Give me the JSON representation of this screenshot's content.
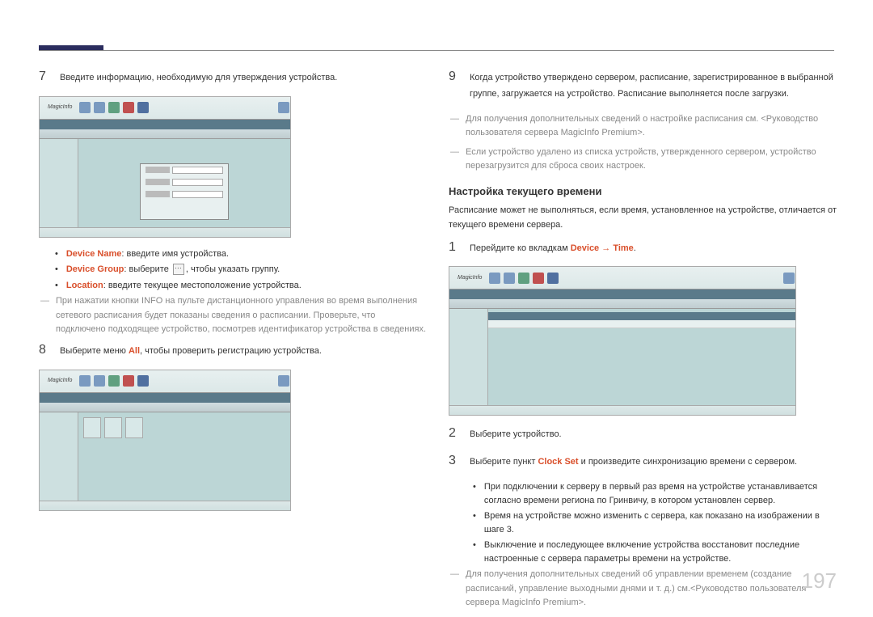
{
  "page_number": "197",
  "left": {
    "step7": "Введите информацию, необходимую для утверждения устройства.",
    "bullets": [
      {
        "label": "Device Name",
        "text": ": введите имя устройства."
      },
      {
        "label": "Device Group",
        "text_before": ": выберите ",
        "text_after": ", чтобы указать группу."
      },
      {
        "label": "Location",
        "text": ": введите текущее местоположение устройства."
      }
    ],
    "note_info": "При нажатии кнопки INFO на пульте дистанционного управления во время выполнения сетевого расписания будет показаны сведения о расписании. Проверьте, что подключено подходящее устройство, посмотрев идентификатор устройства в сведениях.",
    "step8_pre": "Выберите меню ",
    "step8_hl": "All",
    "step8_post": ", чтобы проверить регистрацию устройства."
  },
  "right": {
    "step9": "Когда устройство утверждено сервером, расписание, зарегистрированное в выбранной группе, загружается на устройство. Расписание выполняется после загрузки.",
    "note1": "Для получения дополнительных сведений о настройке расписания см. <Руководство пользователя сервера MagicInfo Premium>.",
    "note2": "Если устройство удалено из списка устройств, утвержденного сервером, устройство перезагрузится для сброса своих настроек.",
    "section_title": "Настройка текущего времени",
    "section_intro": "Расписание может не выполняться, если время, установленное на устройстве, отличается от текущего времени сервера.",
    "step1_pre": "Перейдите ко вкладкам ",
    "step1_hl1": "Device",
    "step1_arrow": " → ",
    "step1_hl2": "Time",
    "step1_post": ".",
    "step2": "Выберите устройство.",
    "step3_pre": "Выберите пункт ",
    "step3_hl": "Clock Set",
    "step3_post": " и произведите синхронизацию времени с сервером.",
    "sub_bullet1": "При подключении к серверу в первый раз время на устройстве устанавливается согласно времени региона по Гринвичу, в котором установлен сервер.",
    "sub_bullet2": "Время на устройстве можно изменить с сервера, как показано на изображении в шаге 3.",
    "sub_bullet3": "Выключение и последующее включение устройства восстановит последние настроенные с сервера параметры времени на устройстве.",
    "note3": "Для получения дополнительных сведений об управлении временем (создание расписаний, управление выходными днями и т. д.) см.<Руководство пользователя сервера MagicInfo Premium>."
  },
  "screenshot_logo": "MagicInfo"
}
